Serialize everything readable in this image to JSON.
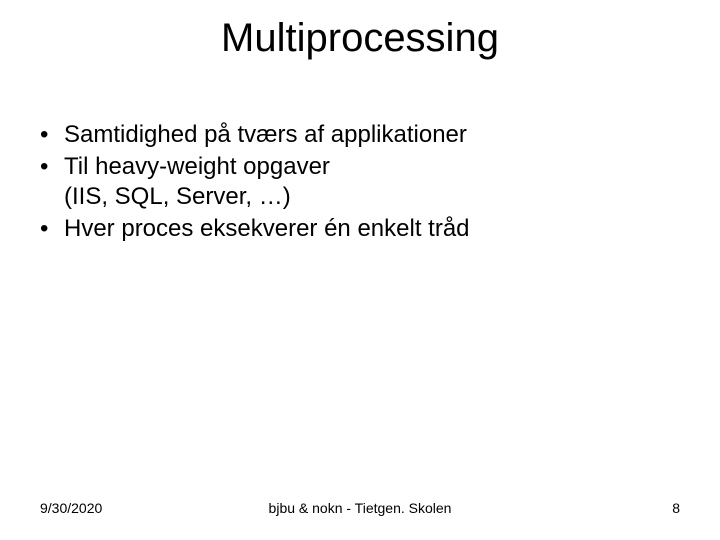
{
  "title": "Multiprocessing",
  "bullets": [
    {
      "text": "Samtidighed på tværs af applikationer"
    },
    {
      "text": "Til heavy-weight opgaver",
      "sub": "(IIS, SQL, Server, …)"
    },
    {
      "text": "Hver proces eksekverer én enkelt tråd"
    }
  ],
  "footer": {
    "date": "9/30/2020",
    "center": "bjbu & nokn - Tietgen. Skolen",
    "page": "8"
  }
}
